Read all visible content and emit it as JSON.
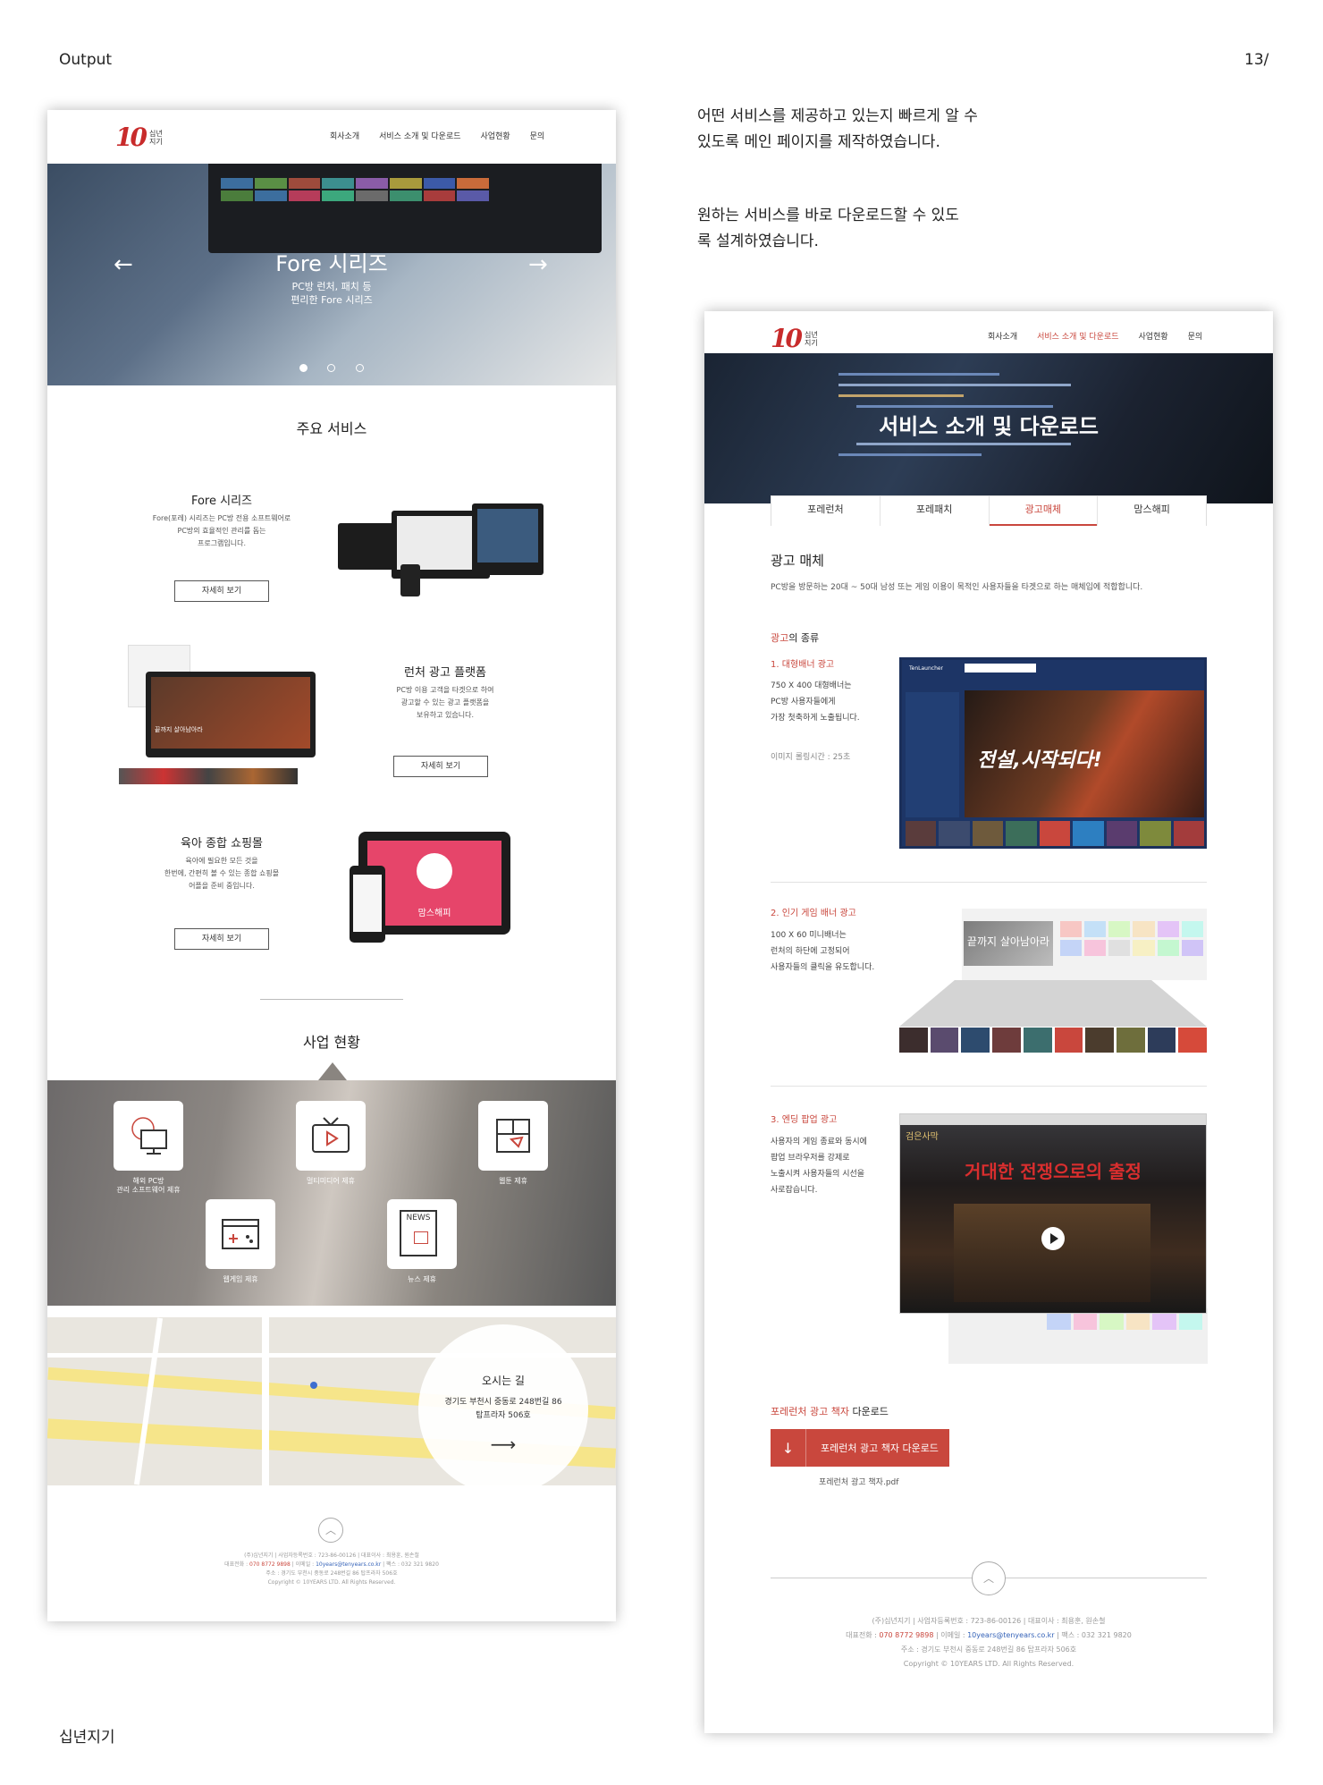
{
  "page": {
    "section_label": "Output",
    "page_number": "13/",
    "brand_label": "십년지기",
    "description_1": "어떤 서비스를 제공하고 있는지 빠르게 알 수 있도록 메인 페이지를 제작하였습니다.",
    "description_2": "원하는 서비스를 바로 다운로드할 수 있도록 설계하였습니다."
  },
  "brand": {
    "logo_mark": "10",
    "logo_text_1": "십년",
    "logo_text_2": "지기",
    "accent": "#c9473d"
  },
  "nav": {
    "items": [
      "회사소개",
      "서비스 소개 및 다운로드",
      "사업현황",
      "문의"
    ],
    "right_active_index": 1
  },
  "left": {
    "hero": {
      "title": "Fore 시리즈",
      "subtitle_1": "PC방 런처, 패치 등",
      "subtitle_2": "편리한 Fore 시리즈",
      "prev_icon": "←",
      "next_icon": "→",
      "slides": 3,
      "active_slide": 1
    },
    "main_services": {
      "title": "주요 서비스",
      "items": [
        {
          "title": "Fore 시리즈",
          "desc_1": "Fore(포레) 시리즈는 PC방 전용 소프트웨어로",
          "desc_2": "PC방의 효율적인 관리를 돕는",
          "desc_3": "프로그램입니다.",
          "button": "자세히 보기"
        },
        {
          "title": "런처 광고 플랫폼",
          "desc_1": "PC방 이용 고객을 타겟으로 하여",
          "desc_2": "광고할 수 있는 광고 플랫폼을",
          "desc_3": "보유하고 있습니다.",
          "button": "자세히 보기"
        },
        {
          "title": "육아 종합 쇼핑몰",
          "desc_1": "육아에 필요한 모든 것을",
          "desc_2": "한번에, 간편히 볼 수 있는 종합 쇼핑몰",
          "desc_3": "어플을 준비 중입니다.",
          "button": "자세히 보기"
        }
      ],
      "mock_text_1": "끝까지 살아남아라",
      "mock_text_2": "맘스해피"
    },
    "business": {
      "title": "사업 현황",
      "items": [
        {
          "icon": "globe-monitor-icon",
          "label_1": "해외 PC방",
          "label_2": "관리 소프트웨어 제휴"
        },
        {
          "icon": "tv-play-icon",
          "label_1": "멀티미디어 제휴",
          "label_2": ""
        },
        {
          "icon": "webtoon-icon",
          "label_1": "웹툰 제휴",
          "label_2": ""
        },
        {
          "icon": "game-window-icon",
          "label_1": "웹게임 제휴",
          "label_2": ""
        },
        {
          "icon": "news-icon",
          "label_1": "뉴스 제휴",
          "label_2": "",
          "icon_text": "NEWS"
        }
      ]
    },
    "location": {
      "title": "오시는 길",
      "address_1": "경기도 부천시 중동로 248번길 86",
      "address_2": "탑프라자 506호",
      "arrow": "⟶"
    }
  },
  "footer": {
    "up_icon": "︿",
    "line_1": "(주)십년지기  |  사업자등록번호 : 723-86-00126  |  대표이사 : 최용훈, 원손철",
    "line_2_pre": "대표전화 : ",
    "phone": "070 8772 9898",
    "line_2_mid": "  |  이메일 : ",
    "email": "10years@tenyears.co.kr",
    "line_2_post": "  |  팩스 : 032 321 9820",
    "line_3": "주소 : 경기도 부천시 중동로 248번길 86 탑프라자 506호",
    "line_4": "Copyright © 10YEARS LTD. All Rights Reserved."
  },
  "right": {
    "banner_title": "서비스 소개 및 다운로드",
    "tabs": [
      "포레런처",
      "포레패치",
      "광고매체",
      "맘스해피"
    ],
    "active_tab": 2,
    "heading": "광고 매체",
    "intro": "PC방을 방문하는 20대 ~ 50대 남성 또는 게임 이용이 목적인 사용자들을 타겟으로 하는 매체입에 적합합니다.",
    "kind_red": "광고",
    "kind_rest": "의 종류",
    "ads": [
      {
        "title": "1. 대형배너 광고",
        "desc_1": "750 X 400 대형배너는",
        "desc_2": "PC방 사용자들에게",
        "desc_3": "가장 첫축하게 노출됩니다.",
        "note": "이미지 롤링시간 : 25초",
        "mock_text": "전설,시작되다!",
        "mock_logo": "TenLauncher"
      },
      {
        "title": "2. 인기 게임 배너 광고",
        "desc_1": "100 X 60 미니배너는",
        "desc_2": "런처의 하단에 고정되어",
        "desc_3": "사용자들의 클릭을 유도합니다.",
        "mock_text": "끝까지 살아남아라"
      },
      {
        "title": "3. 엔딩 팝업 광고",
        "desc_1": "사용자의 게임 종료와 동시에",
        "desc_2": "팝업 브라우저를 강제로",
        "desc_3": "노출시켜 사용자들의 시선을",
        "desc_4": "사로잡습니다.",
        "mock_text": "거대한 전쟁으로의 출정",
        "mock_corner": "검은사막"
      }
    ],
    "download": {
      "title_red": "포레런처 광고 책자",
      "title_rest": " 다운로드",
      "button": "포레런처 광고 책자 다운로드",
      "icon": "↓",
      "file": "포레런처 광고 책자.pdf"
    }
  }
}
